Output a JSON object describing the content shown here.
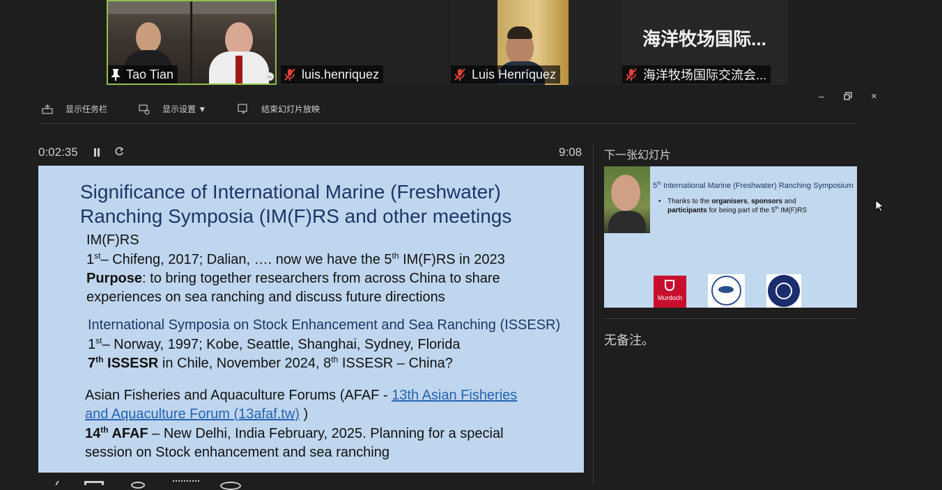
{
  "participants": [
    {
      "name": "Tao Tian",
      "icon": "pin-icon",
      "active": true
    },
    {
      "name": "luis.henriquez",
      "icon": "mic-muted-icon",
      "active": false
    },
    {
      "name": "Luis Henríquez",
      "icon": "mic-muted-icon",
      "active": false
    },
    {
      "name": "海洋牧场国际交流会...",
      "icon": "mic-muted-icon",
      "active": false,
      "placeholder_text": "海洋牧场国际..."
    }
  ],
  "toolbar": {
    "show_taskbar": "显示任务栏",
    "display_settings": "显示设置 ▼",
    "end_slideshow": "结束幻灯片放映"
  },
  "timer": {
    "elapsed": "0:02:35",
    "clock": "9:08"
  },
  "next_slide": {
    "label": "下一张幻灯片",
    "title_pre": "5",
    "title_sup": "th",
    "title_post": " International Marine (Freshwater) Ranching Symposium",
    "bullet_a": "Thanks to the ",
    "bullet_b": "organisers",
    "bullet_c": ", ",
    "bullet_d": "sponsors",
    "bullet_e": " and",
    "bullet_f": "participants",
    "bullet_g": " for being part of the 5",
    "bullet_h": "th",
    "bullet_i": " IM(F)RS",
    "logo_text": "Murdoch"
  },
  "notes": "无备注。",
  "slide": {
    "title_line1": "Significance of International Marine (Freshwater)",
    "title_line2": "Ranching Symposia (IM(F)RS and other meetings",
    "imfrs_heading": "IM(F)RS",
    "imfrs_l1_a": "1",
    "imfrs_l1_sup": "st",
    "imfrs_l1_b": "– Chifeng, 2017; Dalian, …. now we have the 5",
    "imfrs_l1_sup2": "th",
    "imfrs_l1_c": " IM(F)RS in 2023",
    "purpose_label": "Purpose",
    "purpose_l1": ": to bring together researchers from across China to share",
    "purpose_l2": "experiences on sea ranching and discuss future directions",
    "issesr_heading": "International Symposia on Stock Enhancement and Sea Ranching (ISSESR)",
    "issesr_l1_a": "1",
    "issesr_l1_sup": "st",
    "issesr_l1_b": "– Norway, 1997; Kobe, Seattle, Shanghai, Sydney, Florida",
    "issesr_l2_a": "7",
    "issesr_l2_sup": "th",
    "issesr_l2_b": " ISSESR",
    "issesr_l2_c": " in Chile, November 2024, 8",
    "issesr_l2_sup2": "th",
    "issesr_l2_d": " ISSESR – China?",
    "afaf_l1_a": "Asian Fisheries and Aquaculture Forums (AFAF - ",
    "afaf_link1": "13th Asian Fisheries",
    "afaf_link2": "and Aquaculture Forum (13afaf.tw)",
    "afaf_l2_b": " )",
    "afaf_l3_a": "14",
    "afaf_l3_sup": "th",
    "afaf_l3_b": " AFAF",
    "afaf_l3_c": " – New Delhi, India February, 2025. Planning for a special",
    "afaf_l4": "session on Stock enhancement and sea ranching"
  }
}
